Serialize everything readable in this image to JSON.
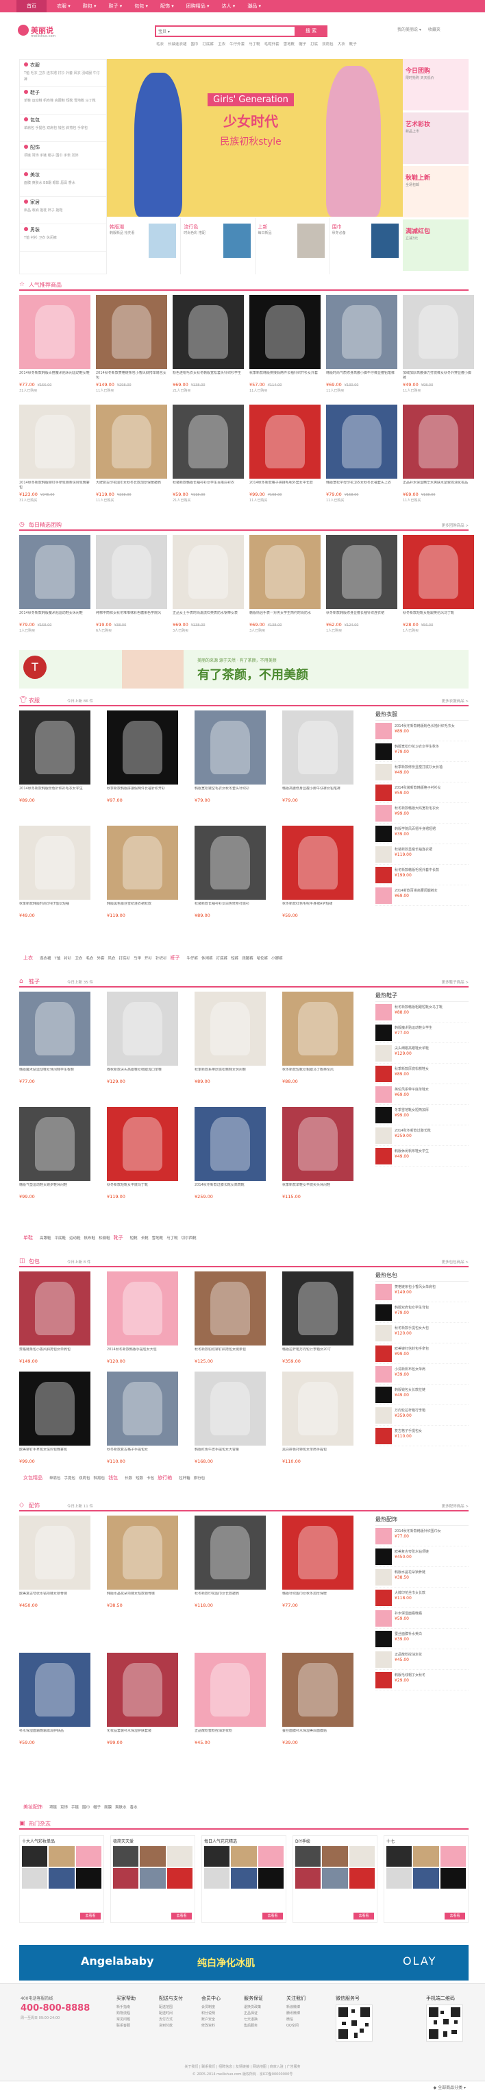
{
  "topnav": {
    "home": "首页",
    "items": [
      "衣服 ▾",
      "鞋包 ▾",
      "鞋子 ▾",
      "包包 ▾",
      "配饰 ▾",
      "团购精品 ▾",
      "达人 ▾",
      "潮品 ▾"
    ]
  },
  "header": {
    "logo_name": "美丽说",
    "logo_url": "meilishuo.com",
    "search_select": "宝贝 ▾",
    "search_button": "搜 索",
    "hot_words": [
      "毛衣",
      "长袖连衣裙",
      "围巾",
      "打底裤",
      "卫衣",
      "牛仔外套",
      "马丁靴",
      "毛呢外套",
      "雪地靴",
      "帽子",
      "打底",
      "双肩包",
      "大衣",
      "靴子"
    ],
    "right_links": [
      "我的美丽说 ▾",
      "收藏夹"
    ]
  },
  "categories": [
    {
      "title": "衣服",
      "sub": "T恤 毛衣 卫衣 连衣裙 衬衫 外套 风衣 羽绒服 牛仔裤"
    },
    {
      "title": "鞋子",
      "sub": "单鞋 运动鞋 帆布鞋 高跟鞋 短靴 雪地靴 马丁靴"
    },
    {
      "title": "包包",
      "sub": "单肩包 手提包 双肩包 钱包 斜挎包 手拿包"
    },
    {
      "title": "配饰",
      "sub": "项链 耳饰 手链 帽子 围巾 手表 发饰"
    },
    {
      "title": "美妆",
      "sub": "面膜 爽肤水 BB霜 眼影 唇膏 香水"
    },
    {
      "title": "家居",
      "sub": "床品 收纳 抱枕 杯子 拖鞋"
    },
    {
      "title": "男装",
      "sub": "T恤 衬衫 卫衣 休闲裤"
    }
  ],
  "banner": {
    "tag": "Girls' Generation",
    "line1": "少女时代",
    "line2": "民族初秋style"
  },
  "side_ads": [
    {
      "title": "今日团购",
      "sub": "限时抢购 天天低价"
    },
    {
      "title": "艺术彩妆",
      "sub": "新品上市"
    },
    {
      "title": "秋鞋上新",
      "sub": "全场包邮"
    },
    {
      "title": "满减红包",
      "sub": "立减3元"
    }
  ],
  "promos": [
    {
      "title": "韩版潮",
      "sub": "韩版新品 抢先看"
    },
    {
      "title": "流行色",
      "sub": "时尚色彩 搭配"
    },
    {
      "title": "上新",
      "sub": "每日新品"
    },
    {
      "title": "围巾",
      "sub": "秋冬必备"
    }
  ],
  "sections": {
    "recommend": {
      "title": "人气推荐商品",
      "sub": "",
      "more": ""
    },
    "daily": {
      "title": "每日精选团购",
      "sub": "",
      "more": "更多团购商品 >"
    },
    "clothes": {
      "title": "衣服",
      "sub": "今日上新 86 件",
      "more": "更多衣服商品 >"
    },
    "shoes": {
      "title": "鞋子",
      "sub": "今日上新 35 件",
      "more": "更多鞋子商品 >"
    },
    "bags": {
      "title": "包包",
      "sub": "今日上新 8 件",
      "more": "更多包包商品 >"
    },
    "acc": {
      "title": "配饰",
      "sub": "今日上新 11 件",
      "more": "更多配饰商品 >"
    },
    "shops": {
      "title": "热门杂志",
      "sub": "",
      "more": ""
    }
  },
  "recommend_items": [
    {
      "desc": "2014秋冬新款韩版百搭魔术贴休闲运动鞋女鞋",
      "price": "¥77.00",
      "old": "¥156.00",
      "sold": "31人已购买"
    },
    {
      "desc": "2014秋冬新款菱格链条包小香风斜挎单肩包女包",
      "price": "¥149.00",
      "old": "¥298.00",
      "sold": "11人已购买"
    },
    {
      "desc": "粉色连帽毛衣女秋冬韩版宽松套头针织衫学生",
      "price": "¥69.00",
      "old": "¥138.00",
      "sold": "21人已购买"
    },
    {
      "desc": "秋季新款韩版拼接假两件长袖针织开衫女外套",
      "price": "¥57.00",
      "old": "¥114.00",
      "sold": "11人已购买"
    },
    {
      "desc": "韩版时尚气质修身高腰小脚牛仔裤显瘦铅笔裤",
      "price": "¥69.00",
      "old": "¥130.00",
      "sold": "11人已购买"
    },
    {
      "desc": "加绒加厚高腰弹力打底裤女秋冬外穿显瘦小脚裤",
      "price": "¥49.00",
      "old": "¥98.00",
      "sold": "11人已购买"
    },
    {
      "desc": "2014秋冬新款韩版铆钉手拿包链条信封包晚宴包",
      "price": "¥123.00",
      "old": "¥246.00",
      "sold": "31人已购买"
    },
    {
      "desc": "大牌复古印花围巾女秋冬长款加厚保暖披肩",
      "price": "¥119.00",
      "old": "¥238.00",
      "sold": "11人已购买"
    },
    {
      "desc": "秋装新款韩版长袖衬衫女学生百搭白衬衣",
      "price": "¥59.00",
      "old": "¥118.00",
      "sold": "21人已购买"
    },
    {
      "desc": "2014秋冬新款格子拼接毛呢外套女中长款",
      "price": "¥99.00",
      "old": "¥198.00",
      "sold": "11人已购买"
    },
    {
      "desc": "韩版宽松字母印花卫衣女秋冬长袖套头上衣",
      "price": "¥79.00",
      "old": "¥158.00",
      "sold": "11人已购买"
    },
    {
      "desc": "正品补水保湿精华水爽肤水紧致控油化妆品",
      "price": "¥69.00",
      "old": "¥138.00",
      "sold": "11人已购买"
    }
  ],
  "daily_items": [
    {
      "desc": "2014秋冬新款韩版魔术贴运动鞋女休闲鞋",
      "price": "¥79.00",
      "old": "¥158.00",
      "sold": "1人已购买"
    },
    {
      "desc": "纯棉中筒袜女秋冬堆堆袜彩色糖果色学院风",
      "price": "¥19.00",
      "old": "¥38.00",
      "sold": "6人已购买"
    },
    {
      "desc": "正品女士手表时尚潮流石英表防水钢带女表",
      "price": "¥69.00",
      "old": "¥138.00",
      "sold": "3人已购买"
    },
    {
      "desc": "韩版情侣手表一对男女学生简约时尚防水",
      "price": "¥69.00",
      "old": "¥138.00",
      "sold": "3人已购买"
    },
    {
      "desc": "秋冬新款韩版修身显瘦长袖针织连衣裙",
      "price": "¥62.00",
      "old": "¥124.00",
      "sold": "1人已购买"
    },
    {
      "desc": "秋冬新款短靴女粗跟英伦风马丁靴",
      "price": "¥28.00",
      "old": "¥56.00",
      "sold": "1人已购买"
    }
  ],
  "midbanner": {
    "logo": "T",
    "line1": "美丽的来源 源于天然 · 有了茶颜，不用美颜",
    "line2": "有了茶颜，不用美颜"
  },
  "clothes_items": [
    {
      "desc": "2014秋冬新款韩版粉色针织衫毛衣女学生",
      "price": "¥89.00"
    },
    {
      "desc": "秋季新款韩版拼接假两件长袖针织开衫",
      "price": "¥97.00"
    },
    {
      "desc": "韩版宽松镂空毛衣女秋冬套头针织衫",
      "price": "¥79.00"
    },
    {
      "desc": "韩版高腰修身显瘦小脚牛仔裤女铅笔裤",
      "price": "¥79.00"
    },
    {
      "desc": "秋季新款韩版时尚印花T恤女短袖",
      "price": "¥49.00"
    },
    {
      "desc": "韩版黑色蕾丝雪纺连衣裙秋款",
      "price": "¥119.00"
    },
    {
      "desc": "秋装新款长袖衬衫女白色修身打底衫",
      "price": "¥89.00"
    },
    {
      "desc": "秋冬新款红色毛呢半身裙A字短裙",
      "price": "¥59.00"
    }
  ],
  "clothes_rank": [
    {
      "t": "2014秋冬新款韩版粉色长袖针织毛衣女",
      "p": "¥89.00"
    },
    {
      "t": "韩版宽松印花卫衣女学生秋冬",
      "p": "¥79.00"
    },
    {
      "t": "秋季新款修身显瘦打底衫女长袖",
      "p": "¥49.00"
    },
    {
      "t": "2014秋装新款韩版格子衬衫女",
      "p": "¥59.00"
    },
    {
      "t": "秋冬新款韩版大码宽松毛衣女",
      "p": "¥99.00"
    },
    {
      "t": "韩版学院风百褶半身裙短裙",
      "p": "¥39.00"
    },
    {
      "t": "秋装新款显瘦长袖连衣裙",
      "p": "¥119.00"
    },
    {
      "t": "秋冬新款韩版毛呢外套中长款",
      "p": "¥199.00"
    },
    {
      "t": "2014新款百搭高腰阔腿裤女",
      "p": "¥69.00"
    }
  ],
  "clothes_links": {
    "h1": "上衣",
    "a": [
      "连衣裙",
      "T恤",
      "衬衫",
      "卫衣",
      "毛衣",
      "外套",
      "风衣",
      "打底衫",
      "马甲",
      "开衫",
      "针织衫"
    ],
    "h2": "裤子",
    "b": [
      "牛仔裤",
      "休闲裤",
      "打底裤",
      "短裤",
      "阔腿裤",
      "哈伦裤",
      "小脚裤"
    ]
  },
  "shoes_items": [
    {
      "desc": "韩版魔术贴运动鞋女休闲鞋学生板鞋",
      "price": "¥77.00"
    },
    {
      "desc": "春秋新款尖头高跟鞋女细跟浅口单鞋",
      "price": "¥129.00"
    },
    {
      "desc": "秋季新款系带厚底松糕鞋女休闲鞋",
      "price": "¥89.00"
    },
    {
      "desc": "秋冬新款短靴女粗跟马丁靴英伦风",
      "price": "¥88.00"
    },
    {
      "desc": "韩版气垫运动鞋女跑步鞋休闲鞋",
      "price": "¥99.00"
    },
    {
      "desc": "秋冬新款短靴女平底马丁靴",
      "price": "¥119.00"
    },
    {
      "desc": "2014秋冬新款过膝长靴女高筒靴",
      "price": "¥259.00"
    },
    {
      "desc": "秋季新款单鞋女平底尖头休闲鞋",
      "price": "¥115.00"
    }
  ],
  "shoes_rank": [
    {
      "t": "秋冬新款韩版粗跟短靴女马丁靴",
      "p": "¥88.00"
    },
    {
      "t": "韩版魔术贴运动鞋女学生",
      "p": "¥77.00"
    },
    {
      "t": "尖头细跟高跟鞋女单鞋",
      "p": "¥129.00"
    },
    {
      "t": "秋季新款厚底松糕鞋女",
      "p": "¥89.00"
    },
    {
      "t": "英伦风系带平底单鞋女",
      "p": "¥69.00"
    },
    {
      "t": "冬季雪地靴女短筒加厚",
      "p": "¥99.00"
    },
    {
      "t": "2014秋冬新款过膝长靴",
      "p": "¥259.00"
    },
    {
      "t": "韩版休闲帆布鞋女学生",
      "p": "¥49.00"
    }
  ],
  "shoes_links": {
    "h1": "单鞋",
    "a": [
      "高跟鞋",
      "平底鞋",
      "运动鞋",
      "帆布鞋",
      "松糕鞋"
    ],
    "h2": "靴子",
    "b": [
      "短靴",
      "长靴",
      "雪地靴",
      "马丁靴",
      "切尔西靴"
    ]
  },
  "bags_items": [
    {
      "desc": "菱格链条包小香风斜挎包女单肩包",
      "price": "¥149.00"
    },
    {
      "desc": "2014秋冬新款韩版手提包女大包",
      "price": "¥120.00"
    },
    {
      "desc": "秋冬新款豹纹铆钉斜挎包女链条包",
      "price": "¥125.00"
    },
    {
      "desc": "韩版拉杆箱万向轮行李箱女20寸",
      "price": "¥359.00"
    },
    {
      "desc": "欧美铆钉手拿包女信封包晚宴包",
      "price": "¥99.00"
    },
    {
      "desc": "秋冬新款复古格子手提包女",
      "price": "¥110.00"
    },
    {
      "desc": "韩版红色牛皮手提包女大容量",
      "price": "¥168.00"
    },
    {
      "desc": "黑白拼色托特包女单肩手提包",
      "price": "¥110.00"
    }
  ],
  "bags_rank": [
    {
      "t": "菱格链条包小香风女单肩包",
      "p": "¥149.00"
    },
    {
      "t": "韩版双肩包女学生背包",
      "p": "¥79.00"
    },
    {
      "t": "秋冬新款手提包女大包",
      "p": "¥120.00"
    },
    {
      "t": "欧美铆钉信封包手拿包",
      "p": "¥99.00"
    },
    {
      "t": "小清新帆布包女单肩",
      "p": "¥39.00"
    },
    {
      "t": "韩版钱包女长款拉链",
      "p": "¥49.00"
    },
    {
      "t": "万向轮拉杆箱行李箱",
      "p": "¥359.00"
    },
    {
      "t": "复古格子手提包女",
      "p": "¥110.00"
    }
  ],
  "bags_links": {
    "h1": "女包精品",
    "a": [
      "单肩包",
      "手提包",
      "双肩包",
      "斜挎包"
    ],
    "h2": "钱包",
    "b": [
      "长款",
      "短款",
      "卡包"
    ],
    "h3": "旅行箱",
    "c": [
      "拉杆箱",
      "旅行包"
    ]
  },
  "acc_items": [
    {
      "desc": "欧美复古夸张水钻项链女锁骨链",
      "price": "¥450.00"
    },
    {
      "desc": "韩版水晶花朵项链女短款锁骨链",
      "price": "¥38.50"
    },
    {
      "desc": "秋冬新款印花围巾女长款披肩",
      "price": "¥118.00"
    },
    {
      "desc": "韩版针织围巾女秋冬加厚保暖",
      "price": "¥77.00"
    },
    {
      "desc": "补水保湿面霜晚霜滋润护肤品",
      "price": "¥59.00"
    },
    {
      "desc": "化妆品套装补水保湿护肤套装",
      "price": "¥99.00"
    },
    {
      "desc": "正品散粉蜜粉控油定妆粉",
      "price": "¥45.00"
    },
    {
      "desc": "蚕丝面膜补水保湿美白面膜贴",
      "price": "¥39.00"
    }
  ],
  "acc_rank": [
    {
      "t": "2014秋冬新款韩版针织围巾女",
      "p": "¥77.00"
    },
    {
      "t": "欧美复古夸张水钻项链",
      "p": "¥450.00"
    },
    {
      "t": "韩版水晶花朵锁骨链",
      "p": "¥38.50"
    },
    {
      "t": "大牌印花丝巾女长款",
      "p": "¥118.00"
    },
    {
      "t": "补水保湿面霜晚霜",
      "p": "¥59.00"
    },
    {
      "t": "蚕丝面膜补水美白",
      "p": "¥39.00"
    },
    {
      "t": "正品散粉控油定妆",
      "p": "¥45.00"
    },
    {
      "t": "韩版毛线帽子女秋冬",
      "p": "¥29.00"
    }
  ],
  "acc_links": {
    "h1": "美妆配饰",
    "a": [
      "项链",
      "耳饰",
      "手链",
      "围巾",
      "帽子",
      "面膜",
      "爽肤水",
      "香水"
    ]
  },
  "shops": [
    {
      "title": "十大人气彩妆单品",
      "btn": "去看看"
    },
    {
      "title": "极简天天爱",
      "btn": "去看看"
    },
    {
      "title": "每日人气花花精选",
      "btn": "去看看"
    },
    {
      "title": "DIY手绘",
      "btn": "去看看"
    },
    {
      "title": "十七",
      "btn": "去看看"
    }
  ],
  "botbanner": {
    "left": "Angelababy",
    "mid": "纯白净化冰肌",
    "right": "OLAY"
  },
  "footer": {
    "cs1": "400电话客服热线",
    "phone": "400-800-8888",
    "cs3": "周一至周日 09:00-24:00",
    "cols": [
      {
        "h": "买家帮助",
        "i": [
          "新手指南",
          "购物流程",
          "常见问题",
          "联系客服"
        ]
      },
      {
        "h": "配送与支付",
        "i": [
          "配送范围",
          "配送时间",
          "支付方式",
          "货到付款"
        ]
      },
      {
        "h": "会员中心",
        "i": [
          "会员制度",
          "积分说明",
          "账户安全",
          "修改资料"
        ]
      },
      {
        "h": "服务保证",
        "i": [
          "退换货政策",
          "正品保证",
          "七天退换",
          "售后服务"
        ]
      },
      {
        "h": "关注我们",
        "i": [
          "新浪微博",
          "腾讯微博",
          "微信",
          "QQ空间"
        ]
      }
    ],
    "qr1": "微信服务号",
    "qr2": "手机端二维码",
    "links": "关于我们 | 联系我们 | 招聘信息 | 友情链接 | 网站地图 | 商家入驻 | 广告服务",
    "copyright": "© 2005-2014 meilishuo.com 版权所有 · 京ICP备00000000号"
  },
  "bottombar": {
    "text": "◆ 全部商品分类 ▾"
  }
}
